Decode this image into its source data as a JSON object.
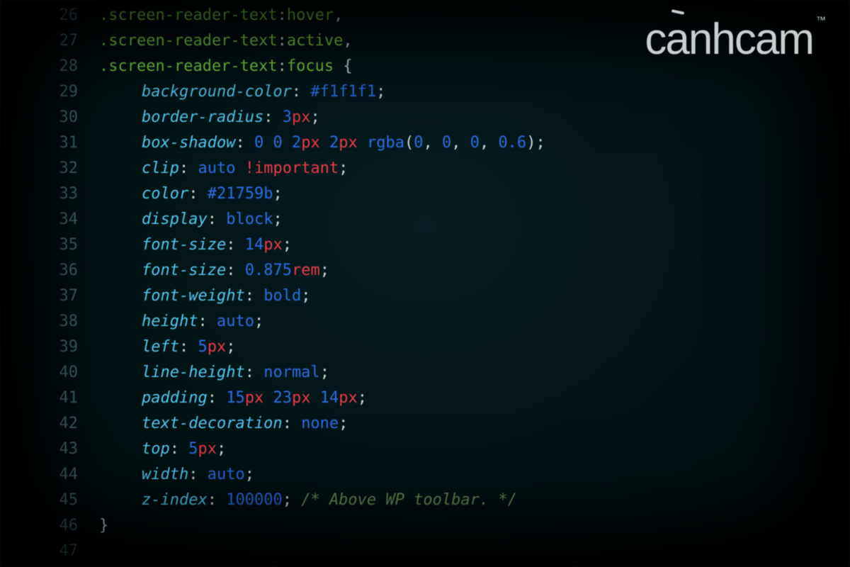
{
  "logo": {
    "text": "cánhcam",
    "trademark": "™"
  },
  "colors": {
    "bg": "#0a1a1c",
    "gutter": "#476a6e",
    "selector": "#7fd24a",
    "property": "#55c3e8",
    "number": "#2e6fe0",
    "unit": "#e83d4a",
    "punct": "#c4d6d8",
    "comment": "#6a8f5a"
  },
  "line_numbers": [
    "26",
    "27",
    "28",
    "29",
    "30",
    "31",
    "32",
    "33",
    "34",
    "35",
    "36",
    "37",
    "38",
    "39",
    "40",
    "41",
    "42",
    "43",
    "44",
    "45",
    "46",
    "47"
  ],
  "lines": [
    {
      "n": "26",
      "type": "selector",
      "selector": ".screen-reader-text",
      "pseudo": "hover",
      "trail": ","
    },
    {
      "n": "27",
      "type": "selector",
      "selector": ".screen-reader-text",
      "pseudo": "active",
      "trail": ","
    },
    {
      "n": "28",
      "type": "selector",
      "selector": ".screen-reader-text",
      "pseudo": "focus",
      "trail": " {"
    },
    {
      "n": "29",
      "type": "decl",
      "prop": "background-color",
      "value": [
        {
          "t": "hex",
          "v": "#f1f1f1"
        }
      ]
    },
    {
      "n": "30",
      "type": "decl",
      "prop": "border-radius",
      "value": [
        {
          "t": "num",
          "v": "3"
        },
        {
          "t": "unit",
          "v": "px"
        }
      ]
    },
    {
      "n": "31",
      "type": "decl",
      "prop": "box-shadow",
      "value": [
        {
          "t": "num",
          "v": "0"
        },
        {
          "t": "sp"
        },
        {
          "t": "num",
          "v": "0"
        },
        {
          "t": "sp"
        },
        {
          "t": "num",
          "v": "2"
        },
        {
          "t": "unit",
          "v": "px"
        },
        {
          "t": "sp"
        },
        {
          "t": "num",
          "v": "2"
        },
        {
          "t": "unit",
          "v": "px"
        },
        {
          "t": "sp"
        },
        {
          "t": "func",
          "v": "rgba"
        },
        {
          "t": "punct",
          "v": "("
        },
        {
          "t": "num",
          "v": "0"
        },
        {
          "t": "punct",
          "v": ", "
        },
        {
          "t": "num",
          "v": "0"
        },
        {
          "t": "punct",
          "v": ", "
        },
        {
          "t": "num",
          "v": "0"
        },
        {
          "t": "punct",
          "v": ", "
        },
        {
          "t": "num",
          "v": "0.6"
        },
        {
          "t": "punct",
          "v": ")"
        }
      ]
    },
    {
      "n": "32",
      "type": "decl",
      "prop": "clip",
      "value": [
        {
          "t": "kw",
          "v": "auto"
        },
        {
          "t": "sp"
        },
        {
          "t": "imp",
          "v": "!important"
        }
      ]
    },
    {
      "n": "33",
      "type": "decl",
      "prop": "color",
      "value": [
        {
          "t": "hex",
          "v": "#21759b"
        }
      ]
    },
    {
      "n": "34",
      "type": "decl",
      "prop": "display",
      "value": [
        {
          "t": "kw",
          "v": "block"
        }
      ]
    },
    {
      "n": "35",
      "type": "decl",
      "prop": "font-size",
      "value": [
        {
          "t": "num",
          "v": "14"
        },
        {
          "t": "unit",
          "v": "px"
        }
      ]
    },
    {
      "n": "36",
      "type": "decl",
      "prop": "font-size",
      "value": [
        {
          "t": "num",
          "v": "0.875"
        },
        {
          "t": "unit",
          "v": "rem"
        }
      ]
    },
    {
      "n": "37",
      "type": "decl",
      "prop": "font-weight",
      "value": [
        {
          "t": "kw",
          "v": "bold"
        }
      ]
    },
    {
      "n": "38",
      "type": "decl",
      "prop": "height",
      "value": [
        {
          "t": "kw",
          "v": "auto"
        }
      ]
    },
    {
      "n": "39",
      "type": "decl",
      "prop": "left",
      "value": [
        {
          "t": "num",
          "v": "5"
        },
        {
          "t": "unit",
          "v": "px"
        }
      ]
    },
    {
      "n": "40",
      "type": "decl",
      "prop": "line-height",
      "value": [
        {
          "t": "kw",
          "v": "normal"
        }
      ]
    },
    {
      "n": "41",
      "type": "decl",
      "prop": "padding",
      "value": [
        {
          "t": "num",
          "v": "15"
        },
        {
          "t": "unit",
          "v": "px"
        },
        {
          "t": "sp"
        },
        {
          "t": "num",
          "v": "23"
        },
        {
          "t": "unit",
          "v": "px"
        },
        {
          "t": "sp"
        },
        {
          "t": "num",
          "v": "14"
        },
        {
          "t": "unit",
          "v": "px"
        }
      ]
    },
    {
      "n": "42",
      "type": "decl",
      "prop": "text-decoration",
      "value": [
        {
          "t": "kw",
          "v": "none"
        }
      ]
    },
    {
      "n": "43",
      "type": "decl",
      "prop": "top",
      "value": [
        {
          "t": "num",
          "v": "5"
        },
        {
          "t": "unit",
          "v": "px"
        }
      ]
    },
    {
      "n": "44",
      "type": "decl",
      "prop": "width",
      "value": [
        {
          "t": "kw",
          "v": "auto"
        }
      ]
    },
    {
      "n": "45",
      "type": "decl",
      "prop": "z-index",
      "value": [
        {
          "t": "num",
          "v": "100000"
        }
      ],
      "comment": "/* Above WP toolbar. */"
    },
    {
      "n": "46",
      "type": "close",
      "text": "}"
    },
    {
      "n": "47",
      "type": "blank"
    }
  ]
}
